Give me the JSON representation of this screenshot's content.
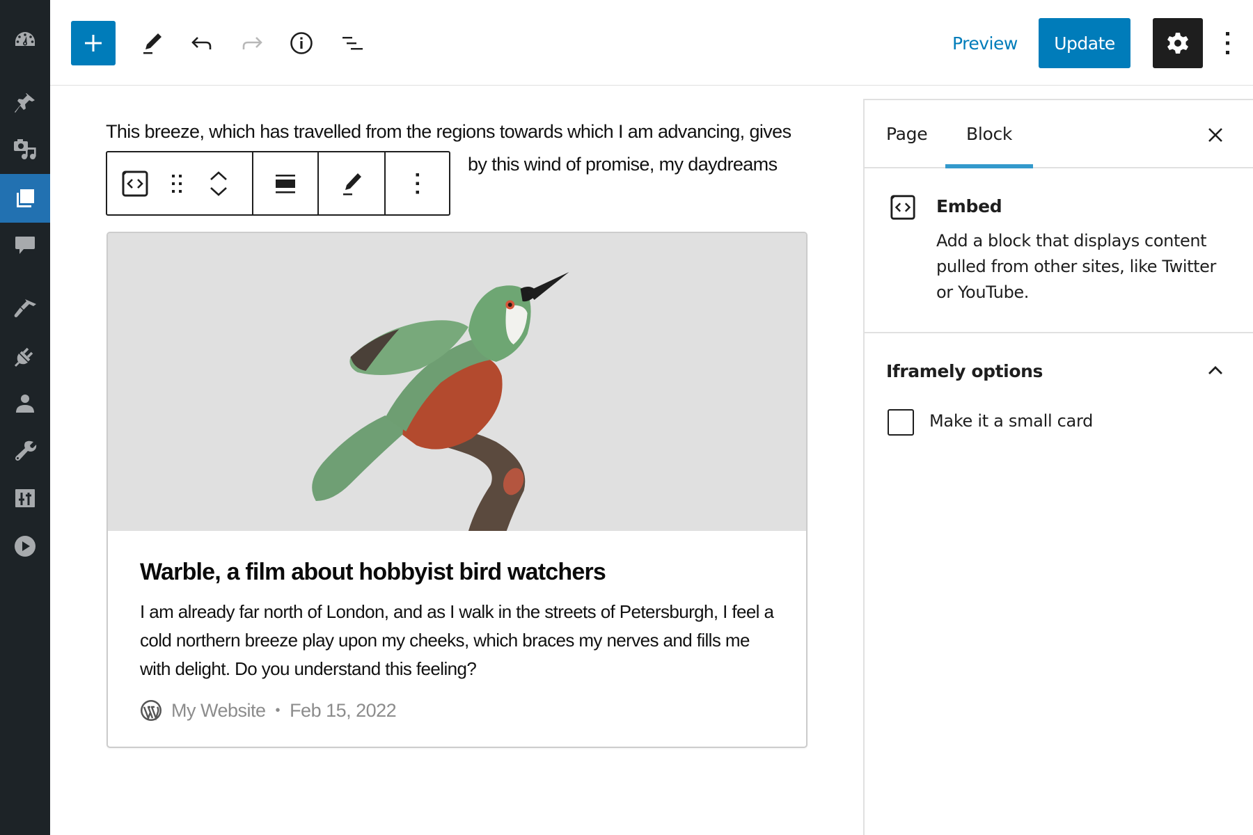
{
  "admin_menu": {
    "items": [
      {
        "name": "dashboard",
        "icon": "dashboard-gauge-icon",
        "active": false
      },
      {
        "name": "posts",
        "icon": "pushpin-icon",
        "active": false
      },
      {
        "name": "media",
        "icon": "media-camera-music-icon",
        "active": false
      },
      {
        "name": "pages",
        "icon": "pages-icon",
        "active": true
      },
      {
        "name": "comments",
        "icon": "comment-bubble-icon",
        "active": false
      },
      {
        "name": "appearance",
        "icon": "paintbrush-icon",
        "active": false
      },
      {
        "name": "plugins",
        "icon": "plug-icon",
        "active": false
      },
      {
        "name": "users",
        "icon": "user-icon",
        "active": false
      },
      {
        "name": "tools",
        "icon": "wrench-icon",
        "active": false
      },
      {
        "name": "settings",
        "icon": "sliders-icon",
        "active": false
      },
      {
        "name": "media-player",
        "icon": "play-circle-icon",
        "active": false
      }
    ]
  },
  "header": {
    "inserter_icon": "plus-icon",
    "tools": [
      "pencil-edit-icon",
      "undo-icon",
      "redo-icon",
      "info-icon",
      "list-view-icon"
    ],
    "redo_disabled": true,
    "preview_label": "Preview",
    "update_label": "Update",
    "settings_icon": "gear-icon",
    "more_icon": "vertical-ellipsis-icon"
  },
  "editor": {
    "paragraph_line1": "This breeze, which has travelled from the regions towards which I am advancing, gives",
    "paragraph_line2": "by this wind of promise, my daydreams",
    "block_toolbar": {
      "block_type_icon": "embed-icon",
      "drag_icon": "drag-handle-icon",
      "move_up_icon": "chevron-up-icon",
      "move_down_icon": "chevron-down-icon",
      "align_icon": "align-wide-icon",
      "edit_icon": "pencil-icon",
      "options_icon": "vertical-ellipsis-icon"
    },
    "embed_card": {
      "image_alt": "Illustration of a green and rufous hummingbird-like bird perched on a branch",
      "title": "Warble, a film about hobbyist bird watchers",
      "description": "I am already far north of London, and as I walk in the streets of Petersburgh, I feel a cold northern breeze play upon my cheeks, which braces my nerves and fills me with delight. Do you understand this feeling?",
      "site_name": "My Website",
      "separator": "•",
      "date": "Feb 15, 2022"
    }
  },
  "sidebar_panel": {
    "tabs": [
      {
        "label": "Page",
        "active": false
      },
      {
        "label": "Block",
        "active": true
      }
    ],
    "close_icon": "close-icon",
    "block": {
      "icon": "embed-icon",
      "name": "Embed",
      "description": "Add a block that displays content pulled from other sites, like Twitter or YouTube."
    },
    "iframely": {
      "title": "Iframely options",
      "expanded": true,
      "checkbox_label": "Make it a small card",
      "checked": false
    }
  },
  "colors": {
    "accent": "#007cba",
    "admin_bg": "#1d2327",
    "admin_active": "#2271b1",
    "tab_indicator": "#3399cc",
    "dark_button": "#1e1e1e",
    "meta_text": "#8c8c8c"
  }
}
